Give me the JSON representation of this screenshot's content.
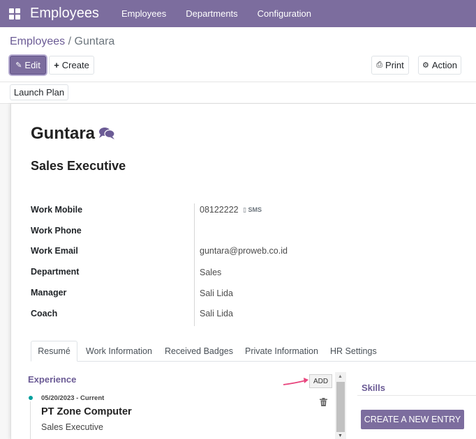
{
  "navbar": {
    "brand": "Employees",
    "menu": [
      "Employees",
      "Departments",
      "Configuration"
    ],
    "colors": {
      "navbar": "#7c6d9e"
    }
  },
  "breadcrumb": {
    "parent": "Employees",
    "separator": "/",
    "current": "Guntara"
  },
  "toolbar": {
    "edit_label": "Edit",
    "create_label": "Create",
    "print_label": "Print",
    "action_label": "Action",
    "launch_plan_label": "Launch Plan"
  },
  "employee": {
    "name": "Guntara",
    "job_title": "Sales Executive",
    "fields": [
      {
        "label": "Work Mobile",
        "value": "08122222"
      },
      {
        "label": "Work Phone",
        "value": ""
      },
      {
        "label": "Work Email",
        "value": "guntara@proweb.co.id"
      },
      {
        "label": "Department",
        "value": "Sales"
      },
      {
        "label": "Manager",
        "value": "Sali Lida"
      },
      {
        "label": "Coach",
        "value": "Sali Lida"
      }
    ],
    "sms_label": "SMS"
  },
  "tabs": [
    "Resumé",
    "Work Information",
    "Received Badges",
    "Private Information",
    "HR Settings"
  ],
  "resume": {
    "experience_title": "Experience",
    "add_label": "ADD",
    "entry": {
      "date": "05/20/2023 - Current",
      "company": "PT Zone Computer",
      "position": "Sales Executive"
    }
  },
  "skills": {
    "title": "Skills",
    "create_label": "CREATE A NEW ENTRY"
  }
}
